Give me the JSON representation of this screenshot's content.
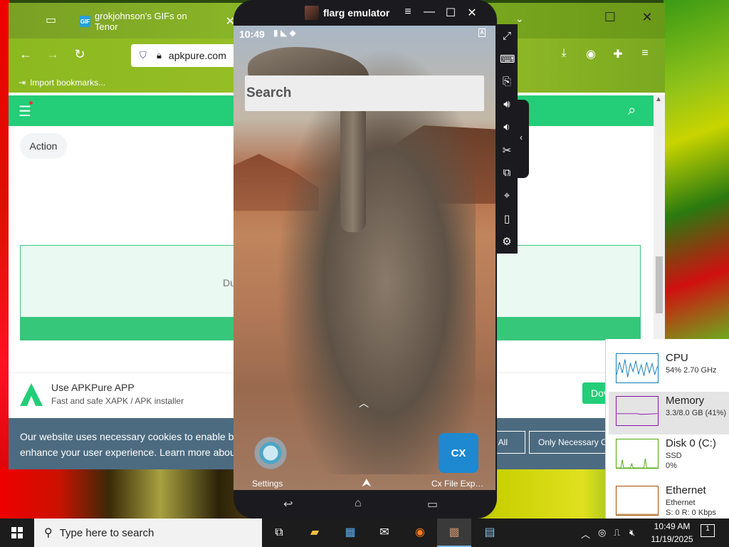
{
  "browser": {
    "tab_title": "grokjohnson's GIFs on Tenor",
    "tab_favicon": "GIF",
    "url": "apkpure.com",
    "bookmark": "Import bookmarks..."
  },
  "page": {
    "chip": "Action",
    "download_box_text": "Du",
    "app_banner_title": "Use APKPure APP",
    "app_banner_sub": "Fast and safe XAPK / APK installer",
    "download_button": "Dov",
    "cookie_line1": "Our website uses necessary cookies to enable b",
    "cookie_line2": "enhance your user experience. Learn more abou",
    "accept_all": "pt All",
    "only_necessary": "Only Necessary C"
  },
  "emulator": {
    "title": "flarg emulator",
    "time": "10:49",
    "search_placeholder": "Search",
    "apps": [
      {
        "label": "Settings"
      },
      {
        "label": "Cx File Exp…",
        "icon_text": "CX"
      }
    ]
  },
  "task_manager": {
    "cpu": {
      "name": "CPU",
      "detail": "54% 2.70 GHz"
    },
    "memory": {
      "name": "Memory",
      "detail": "3.3/8.0 GB (41%)"
    },
    "disk": {
      "name": "Disk 0 (C:)",
      "detail1": "SSD",
      "detail2": "0%"
    },
    "ethernet": {
      "name": "Ethernet",
      "detail1": "Ethernet",
      "detail2": "S: 0 R: 0 Kbps"
    }
  },
  "taskbar": {
    "search_placeholder": "Type here to search",
    "time": "10:49 AM",
    "date": "11/19/2025",
    "notifications": "1"
  },
  "colors": {
    "apk_green": "#24cd77",
    "cookie_bg": "#4c6b80",
    "emulator_frame": "#1b1b1f"
  }
}
